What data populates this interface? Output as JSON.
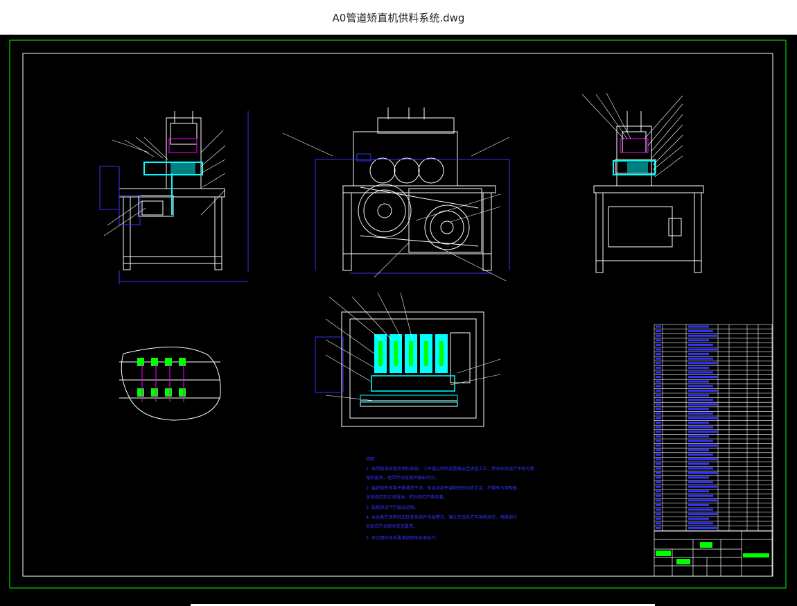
{
  "window": {
    "title": "A0管道矫直机供料系统.dwg"
  },
  "drawing": {
    "colors": {
      "background": "#000000",
      "frame": "#00ff00",
      "border": "#ffffff",
      "blue": "#3333ff",
      "cyan": "#00ffff",
      "magenta": "#ff00ff",
      "green": "#00ff00",
      "yellow": "#ffff00"
    },
    "notes": {
      "heading": "说明",
      "lines": [
        "1. 采用管道矫直机供料系统，工件通过供料装置输送至矫直工位，传动系统运行平稳可靠",
        "   电机驱动，经带传动减速后输出动力。",
        "2. 装配前所有零件需清洗干净，各运动部件装配后转动应灵活，不得有卡滞现象，",
        "   润滑部位加注润滑油，密封部位不得渗漏。",
        "3. 装配后进行空载试运转。",
        "4. 本设备在使用前应检查各部件连接情况，确认无误后方可通电运行，电器部分",
        "   安装应符合相关规范要求。",
        "5. 未注明的技术要求按相关标准执行。"
      ]
    }
  }
}
